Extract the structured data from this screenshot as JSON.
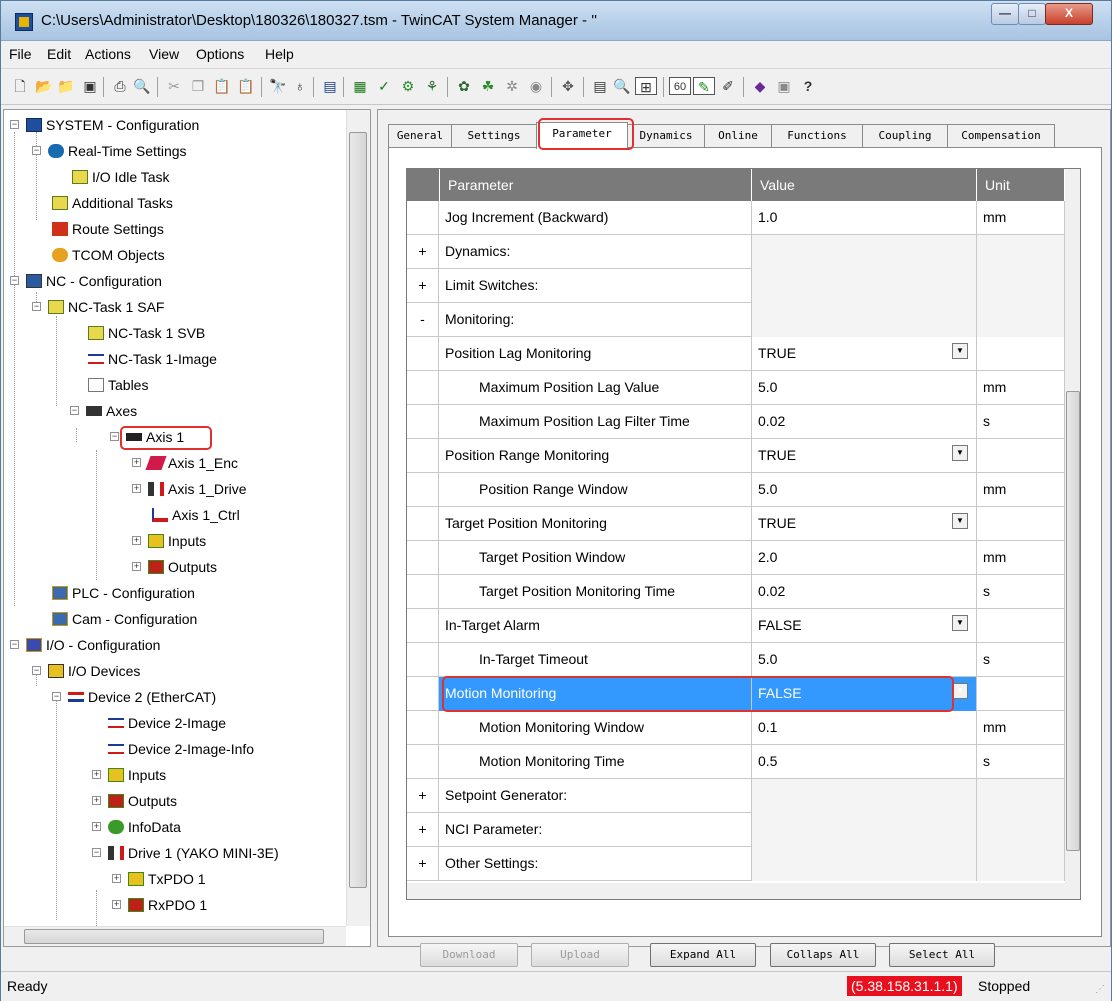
{
  "window": {
    "title": "C:\\Users\\Administrator\\Desktop\\180326\\180327.tsm - TwinCAT System Manager - ''",
    "min_label": "—",
    "max_label": "□",
    "close_label": "X"
  },
  "menu": [
    "File",
    "Edit",
    "Actions",
    "View",
    "Options",
    "Help"
  ],
  "toolbar": {
    "icons": [
      "new-icon",
      "open-icon",
      "open-folder-icon",
      "save-icon",
      "print-icon",
      "print-preview-icon",
      "cut-icon",
      "copy-icon",
      "paste-icon",
      "paste-special-icon",
      "find-icon",
      "find-next-icon",
      "generate-mappings-icon",
      "activate-config-icon",
      "check-icon",
      "restart-icon",
      "set-run-mode-icon",
      "config-mode-icon",
      "scan-icon",
      "toggle-icon",
      "record-icon",
      "target-icon",
      "properties-icon",
      "zoom-icon",
      "check-configuration-icon",
      "online-icon",
      "local-icon",
      "free-run-icon",
      "help-book-icon",
      "info-icon",
      "help-icon"
    ]
  },
  "tree": {
    "items": [
      {
        "label": "SYSTEM - Configuration",
        "icon": "system-config-icon"
      },
      {
        "label": "Real-Time Settings",
        "icon": "realtime-icon"
      },
      {
        "label": "I/O Idle Task",
        "icon": "task-icon"
      },
      {
        "label": "Additional Tasks",
        "icon": "tasks-icon"
      },
      {
        "label": "Route Settings",
        "icon": "route-icon"
      },
      {
        "label": "TCOM Objects",
        "icon": "tcom-icon"
      },
      {
        "label": "NC - Configuration",
        "icon": "nc-config-icon"
      },
      {
        "label": "NC-Task 1 SAF",
        "icon": "task-icon"
      },
      {
        "label": "NC-Task 1 SVB",
        "icon": "task-icon"
      },
      {
        "label": "NC-Task 1-Image",
        "icon": "image-icon"
      },
      {
        "label": "Tables",
        "icon": "table-icon"
      },
      {
        "label": "Axes",
        "icon": "axes-icon"
      },
      {
        "label": "Axis 1",
        "icon": "axis-icon"
      },
      {
        "label": "Axis 1_Enc",
        "icon": "encoder-icon"
      },
      {
        "label": "Axis 1_Drive",
        "icon": "drive-icon"
      },
      {
        "label": "Axis 1_Ctrl",
        "icon": "controller-icon"
      },
      {
        "label": "Inputs",
        "icon": "inputs-icon"
      },
      {
        "label": "Outputs",
        "icon": "outputs-icon"
      },
      {
        "label": "PLC - Configuration",
        "icon": "plc-icon"
      },
      {
        "label": "Cam - Configuration",
        "icon": "cam-icon"
      },
      {
        "label": "I/O - Configuration",
        "icon": "io-config-icon"
      },
      {
        "label": "I/O Devices",
        "icon": "io-devices-icon"
      },
      {
        "label": "Device 2 (EtherCAT)",
        "icon": "ethercat-icon"
      },
      {
        "label": "Device 2-Image",
        "icon": "image-icon"
      },
      {
        "label": "Device 2-Image-Info",
        "icon": "image-icon"
      },
      {
        "label": "Inputs",
        "icon": "inputs-icon"
      },
      {
        "label": "Outputs",
        "icon": "outputs-icon"
      },
      {
        "label": "InfoData",
        "icon": "infodata-icon"
      },
      {
        "label": "Drive 1 (YAKO MINI-3E)",
        "icon": "drive-icon"
      },
      {
        "label": "TxPDO 1",
        "icon": "inputs-icon"
      },
      {
        "label": "RxPDO 1",
        "icon": "outputs-icon"
      }
    ]
  },
  "tabs": [
    "General",
    "Settings",
    "Parameter",
    "Dynamics",
    "Online",
    "Functions",
    "Coupling",
    "Compensation"
  ],
  "grid": {
    "headers": [
      "Parameter",
      "Value",
      "Unit"
    ],
    "rows": [
      {
        "exp": "",
        "name": "Jog Increment (Backward)",
        "value": "1.0",
        "unit": "mm"
      },
      {
        "exp": "+",
        "name": "Dynamics:",
        "value": "",
        "unit": ""
      },
      {
        "exp": "+",
        "name": "Limit Switches:",
        "value": "",
        "unit": ""
      },
      {
        "exp": "-",
        "name": "Monitoring:",
        "value": "",
        "unit": ""
      },
      {
        "exp": "",
        "name": "Position Lag Monitoring",
        "value": "TRUE",
        "unit": ""
      },
      {
        "exp": "",
        "name": "Maximum Position Lag Value",
        "value": "5.0",
        "unit": "mm"
      },
      {
        "exp": "",
        "name": "Maximum Position Lag Filter Time",
        "value": "0.02",
        "unit": "s"
      },
      {
        "exp": "",
        "name": "Position Range Monitoring",
        "value": "TRUE",
        "unit": ""
      },
      {
        "exp": "",
        "name": "Position Range Window",
        "value": "5.0",
        "unit": "mm"
      },
      {
        "exp": "",
        "name": "Target Position Monitoring",
        "value": "TRUE",
        "unit": ""
      },
      {
        "exp": "",
        "name": "Target Position Window",
        "value": "2.0",
        "unit": "mm"
      },
      {
        "exp": "",
        "name": "Target Position Monitoring Time",
        "value": "0.02",
        "unit": "s"
      },
      {
        "exp": "",
        "name": "In-Target Alarm",
        "value": "FALSE",
        "unit": ""
      },
      {
        "exp": "",
        "name": "In-Target Timeout",
        "value": "5.0",
        "unit": "s"
      },
      {
        "exp": "",
        "name": "Motion Monitoring",
        "value": "FALSE",
        "unit": ""
      },
      {
        "exp": "",
        "name": "Motion Monitoring Window",
        "value": "0.1",
        "unit": "mm"
      },
      {
        "exp": "",
        "name": "Motion Monitoring Time",
        "value": "0.5",
        "unit": "s"
      },
      {
        "exp": "+",
        "name": "Setpoint Generator:",
        "value": "",
        "unit": ""
      },
      {
        "exp": "+",
        "name": "NCI Parameter:",
        "value": "",
        "unit": ""
      },
      {
        "exp": "+",
        "name": "Other Settings:",
        "value": "",
        "unit": ""
      }
    ]
  },
  "buttons": {
    "download": "Download",
    "upload": "Upload",
    "expand_all": "Expand All",
    "collaps_all": "Collaps All",
    "select_all": "Select All"
  },
  "status": {
    "text": "Ready",
    "ams": "(5.38.158.31.1.1)",
    "state": "Stopped"
  },
  "colors": {
    "highlight": "#e03030",
    "selection": "#3399ff",
    "header": "#7a7a7a",
    "ams_bg": "#e8101e"
  }
}
